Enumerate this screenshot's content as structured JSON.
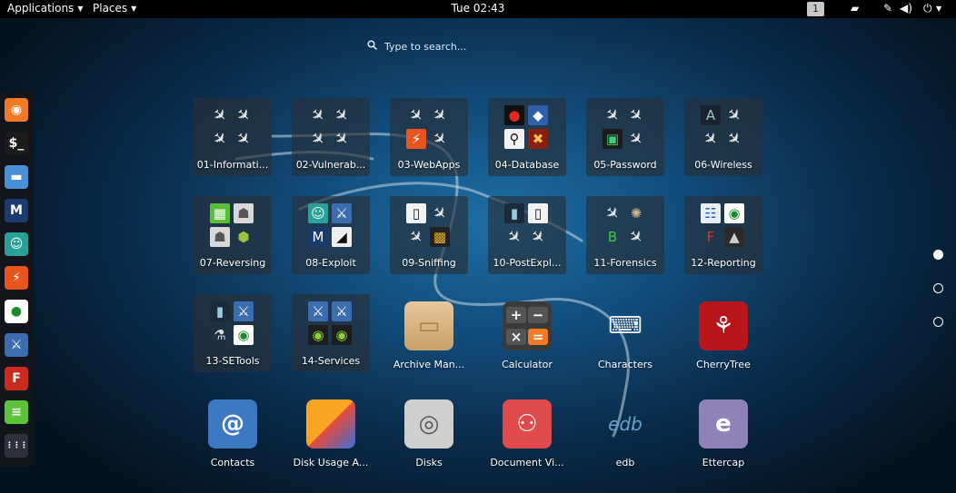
{
  "topbar": {
    "applications_label": "Applications",
    "places_label": "Places",
    "clock": "Tue 02:43",
    "workspace": "1"
  },
  "search": {
    "placeholder": "Type to search..."
  },
  "dash": {
    "items": [
      {
        "name": "burpsuite-icon",
        "glyph": "◉",
        "bg": "#f07a28"
      },
      {
        "name": "terminal-icon",
        "glyph": "$_",
        "bg": "#1b1b1b"
      },
      {
        "name": "files-icon",
        "glyph": "▬",
        "bg": "#4a90d9"
      },
      {
        "name": "metasploit-icon",
        "glyph": "M",
        "bg": "#1d3c6e"
      },
      {
        "name": "armitage-icon",
        "glyph": "☺",
        "bg": "#2aa198"
      },
      {
        "name": "burp-orange-icon",
        "glyph": "⚡",
        "bg": "#e8541e"
      },
      {
        "name": "maltego-icon",
        "glyph": "●",
        "bg": "#ffffff"
      },
      {
        "name": "beef-icon",
        "glyph": "⚔",
        "bg": "#3c6dae"
      },
      {
        "name": "faraday-icon",
        "glyph": "F",
        "bg": "#c92b1d"
      },
      {
        "name": "notes-icon",
        "glyph": "≡",
        "bg": "#5cc33a"
      },
      {
        "name": "show-apps-icon",
        "glyph": "⋮⋮⋮",
        "bg": "#2e3238"
      }
    ]
  },
  "folders": [
    {
      "label": "01-Informati...",
      "icons": [
        "tool",
        "tool",
        "tool",
        "tool"
      ]
    },
    {
      "label": "02-Vulnerab...",
      "icons": [
        "tool",
        "tool",
        "tool",
        "tool"
      ]
    },
    {
      "label": "03-WebApps",
      "icons": [
        "tool",
        "tool",
        "burp",
        "tool"
      ]
    },
    {
      "label": "04-Database",
      "icons": [
        "db",
        "globe",
        "sqlmap",
        "key"
      ]
    },
    {
      "label": "05-Password",
      "icons": [
        "tool",
        "tool",
        "terminal",
        "tool"
      ]
    },
    {
      "label": "06-Wireless",
      "icons": [
        "air",
        "tool",
        "tool",
        "tool"
      ]
    },
    {
      "label": "07-Reversing",
      "icons": [
        "apk",
        "ghost",
        "ghost",
        "android"
      ]
    },
    {
      "label": "08-Exploit",
      "icons": [
        "armitage",
        "beef",
        "metasploit",
        "msf"
      ]
    },
    {
      "label": "09-Sniffing",
      "icons": [
        "frame",
        "tool",
        "tool",
        "colors"
      ]
    },
    {
      "label": "10-PostExpl...",
      "icons": [
        "door",
        "frame",
        "tool",
        "tool"
      ]
    },
    {
      "label": "11-Forensics",
      "icons": [
        "tool",
        "spider",
        "binwalk",
        "tool"
      ]
    },
    {
      "label": "12-Reporting",
      "icons": [
        "report",
        "maltego",
        "faraday",
        "pipal"
      ]
    },
    {
      "label": "13-SETools",
      "icons": [
        "door",
        "beef",
        "lab",
        "maltego"
      ]
    },
    {
      "label": "14-Services",
      "icons": [
        "beef",
        "beef",
        "green",
        "green"
      ]
    }
  ],
  "apps": [
    {
      "label": "Archive Man...",
      "icon": "archive-manager-icon"
    },
    {
      "label": "Calculator",
      "icon": "calculator-icon"
    },
    {
      "label": "Characters",
      "icon": "characters-icon"
    },
    {
      "label": "CherryTree",
      "icon": "cherrytree-icon"
    },
    {
      "label": "Contacts",
      "icon": "contacts-icon"
    },
    {
      "label": "Disk Usage A...",
      "icon": "disk-usage-icon"
    },
    {
      "label": "Disks",
      "icon": "disks-icon"
    },
    {
      "label": "Document Vi...",
      "icon": "document-viewer-icon"
    },
    {
      "label": "edb",
      "icon": "edb-icon"
    },
    {
      "label": "Ettercap",
      "icon": "ettercap-icon"
    }
  ],
  "pages": {
    "count": 3,
    "active": 1
  }
}
